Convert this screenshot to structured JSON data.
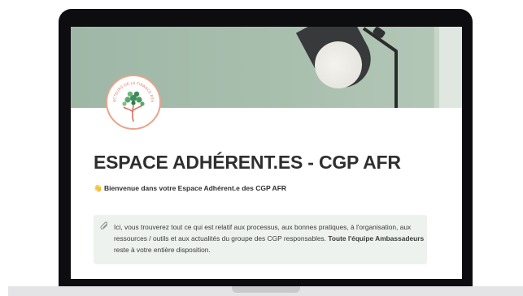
{
  "page": {
    "title": "ESPACE ADHÉRENT.ES - CGP AFR",
    "welcome_emoji": "👋",
    "welcome_text": "Bienvenue dans votre Espace Adhérent.e des CGP AFR",
    "callout": {
      "icon": "paperclip-icon",
      "text_part1": "Ici, vous trouverez tout ce qui est relatif aux processus, aux bonnes pratiques, à l'organisation, aux ressources / outils et aux actualités du groupe des CGP responsables.",
      "text_bold": "Toute l'équipe Ambassadeurs",
      "text_part2": "reste à votre entière disposition."
    },
    "logo_text": "ACTEURS DE LA FINANCE RESPONSABLE"
  },
  "colors": {
    "banner": "#a9bfae",
    "callout_bg": "#eef2ee",
    "logo_ring": "#e7a48b",
    "laptop": "#0d0d0f"
  }
}
